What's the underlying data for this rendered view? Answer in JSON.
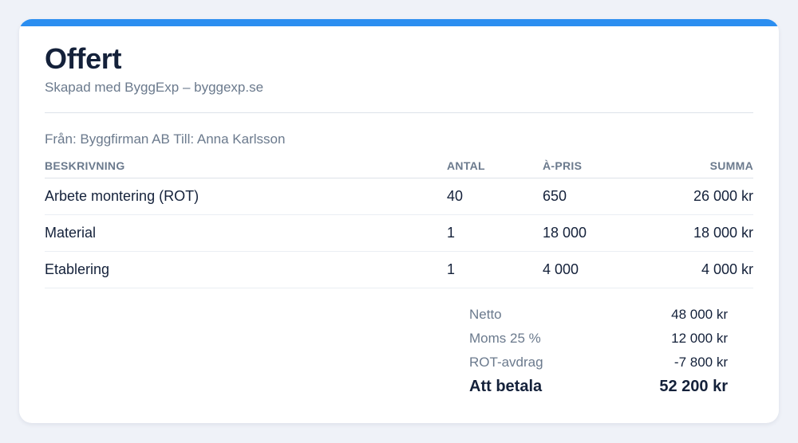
{
  "document": {
    "title": "Offert",
    "subtitle": "Skapad med ByggExp – byggexp.se",
    "parties": "Från: Byggfirman AB Till: Anna Karlsson",
    "accent_color": "#2b8ef0"
  },
  "table": {
    "headers": {
      "description": "BESKRIVNING",
      "quantity": "ANTAL",
      "unit_price": "À-PRIS",
      "sum": "SUMMA"
    },
    "rows": [
      {
        "description": "Arbete montering (ROT)",
        "quantity": "40",
        "unit_price": "650",
        "sum": "26 000 kr"
      },
      {
        "description": "Material",
        "quantity": "1",
        "unit_price": "18 000",
        "sum": "18 000 kr"
      },
      {
        "description": "Etablering",
        "quantity": "1",
        "unit_price": "4 000",
        "sum": "4 000 kr"
      }
    ]
  },
  "totals": {
    "net_label": "Netto",
    "net_value": "48 000 kr",
    "vat_label": "Moms 25 %",
    "vat_value": "12 000 kr",
    "rot_label": "ROT-avdrag",
    "rot_value": "-7 800 kr",
    "due_label": "Att betala",
    "due_value": "52 200 kr"
  }
}
